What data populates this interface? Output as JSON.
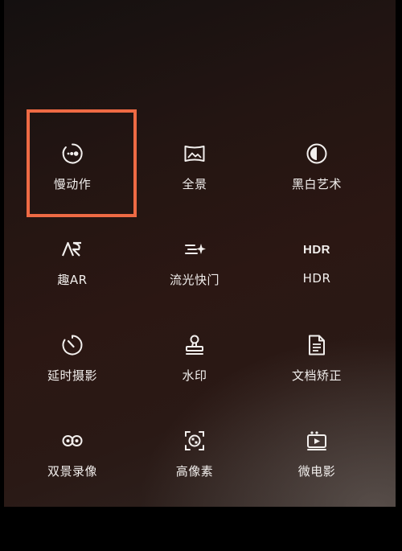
{
  "modes": [
    {
      "label": "慢动作",
      "icon": "slow-motion-icon"
    },
    {
      "label": "全景",
      "icon": "panorama-icon"
    },
    {
      "label": "黑白艺术",
      "icon": "monochrome-icon"
    },
    {
      "label": "趣AR",
      "icon": "ar-icon"
    },
    {
      "label": "流光快门",
      "icon": "light-painting-icon"
    },
    {
      "label": "HDR",
      "icon": "hdr-icon",
      "icon_text": "HDR"
    },
    {
      "label": "延时摄影",
      "icon": "time-lapse-icon"
    },
    {
      "label": "水印",
      "icon": "watermark-stamp-icon"
    },
    {
      "label": "文档矫正",
      "icon": "document-icon"
    },
    {
      "label": "双景录像",
      "icon": "dual-view-icon"
    },
    {
      "label": "高像素",
      "icon": "high-resolution-icon"
    },
    {
      "label": "微电影",
      "icon": "micro-movie-icon"
    }
  ],
  "highlight": {
    "target": "慢动作",
    "color": "#ee6a44"
  }
}
